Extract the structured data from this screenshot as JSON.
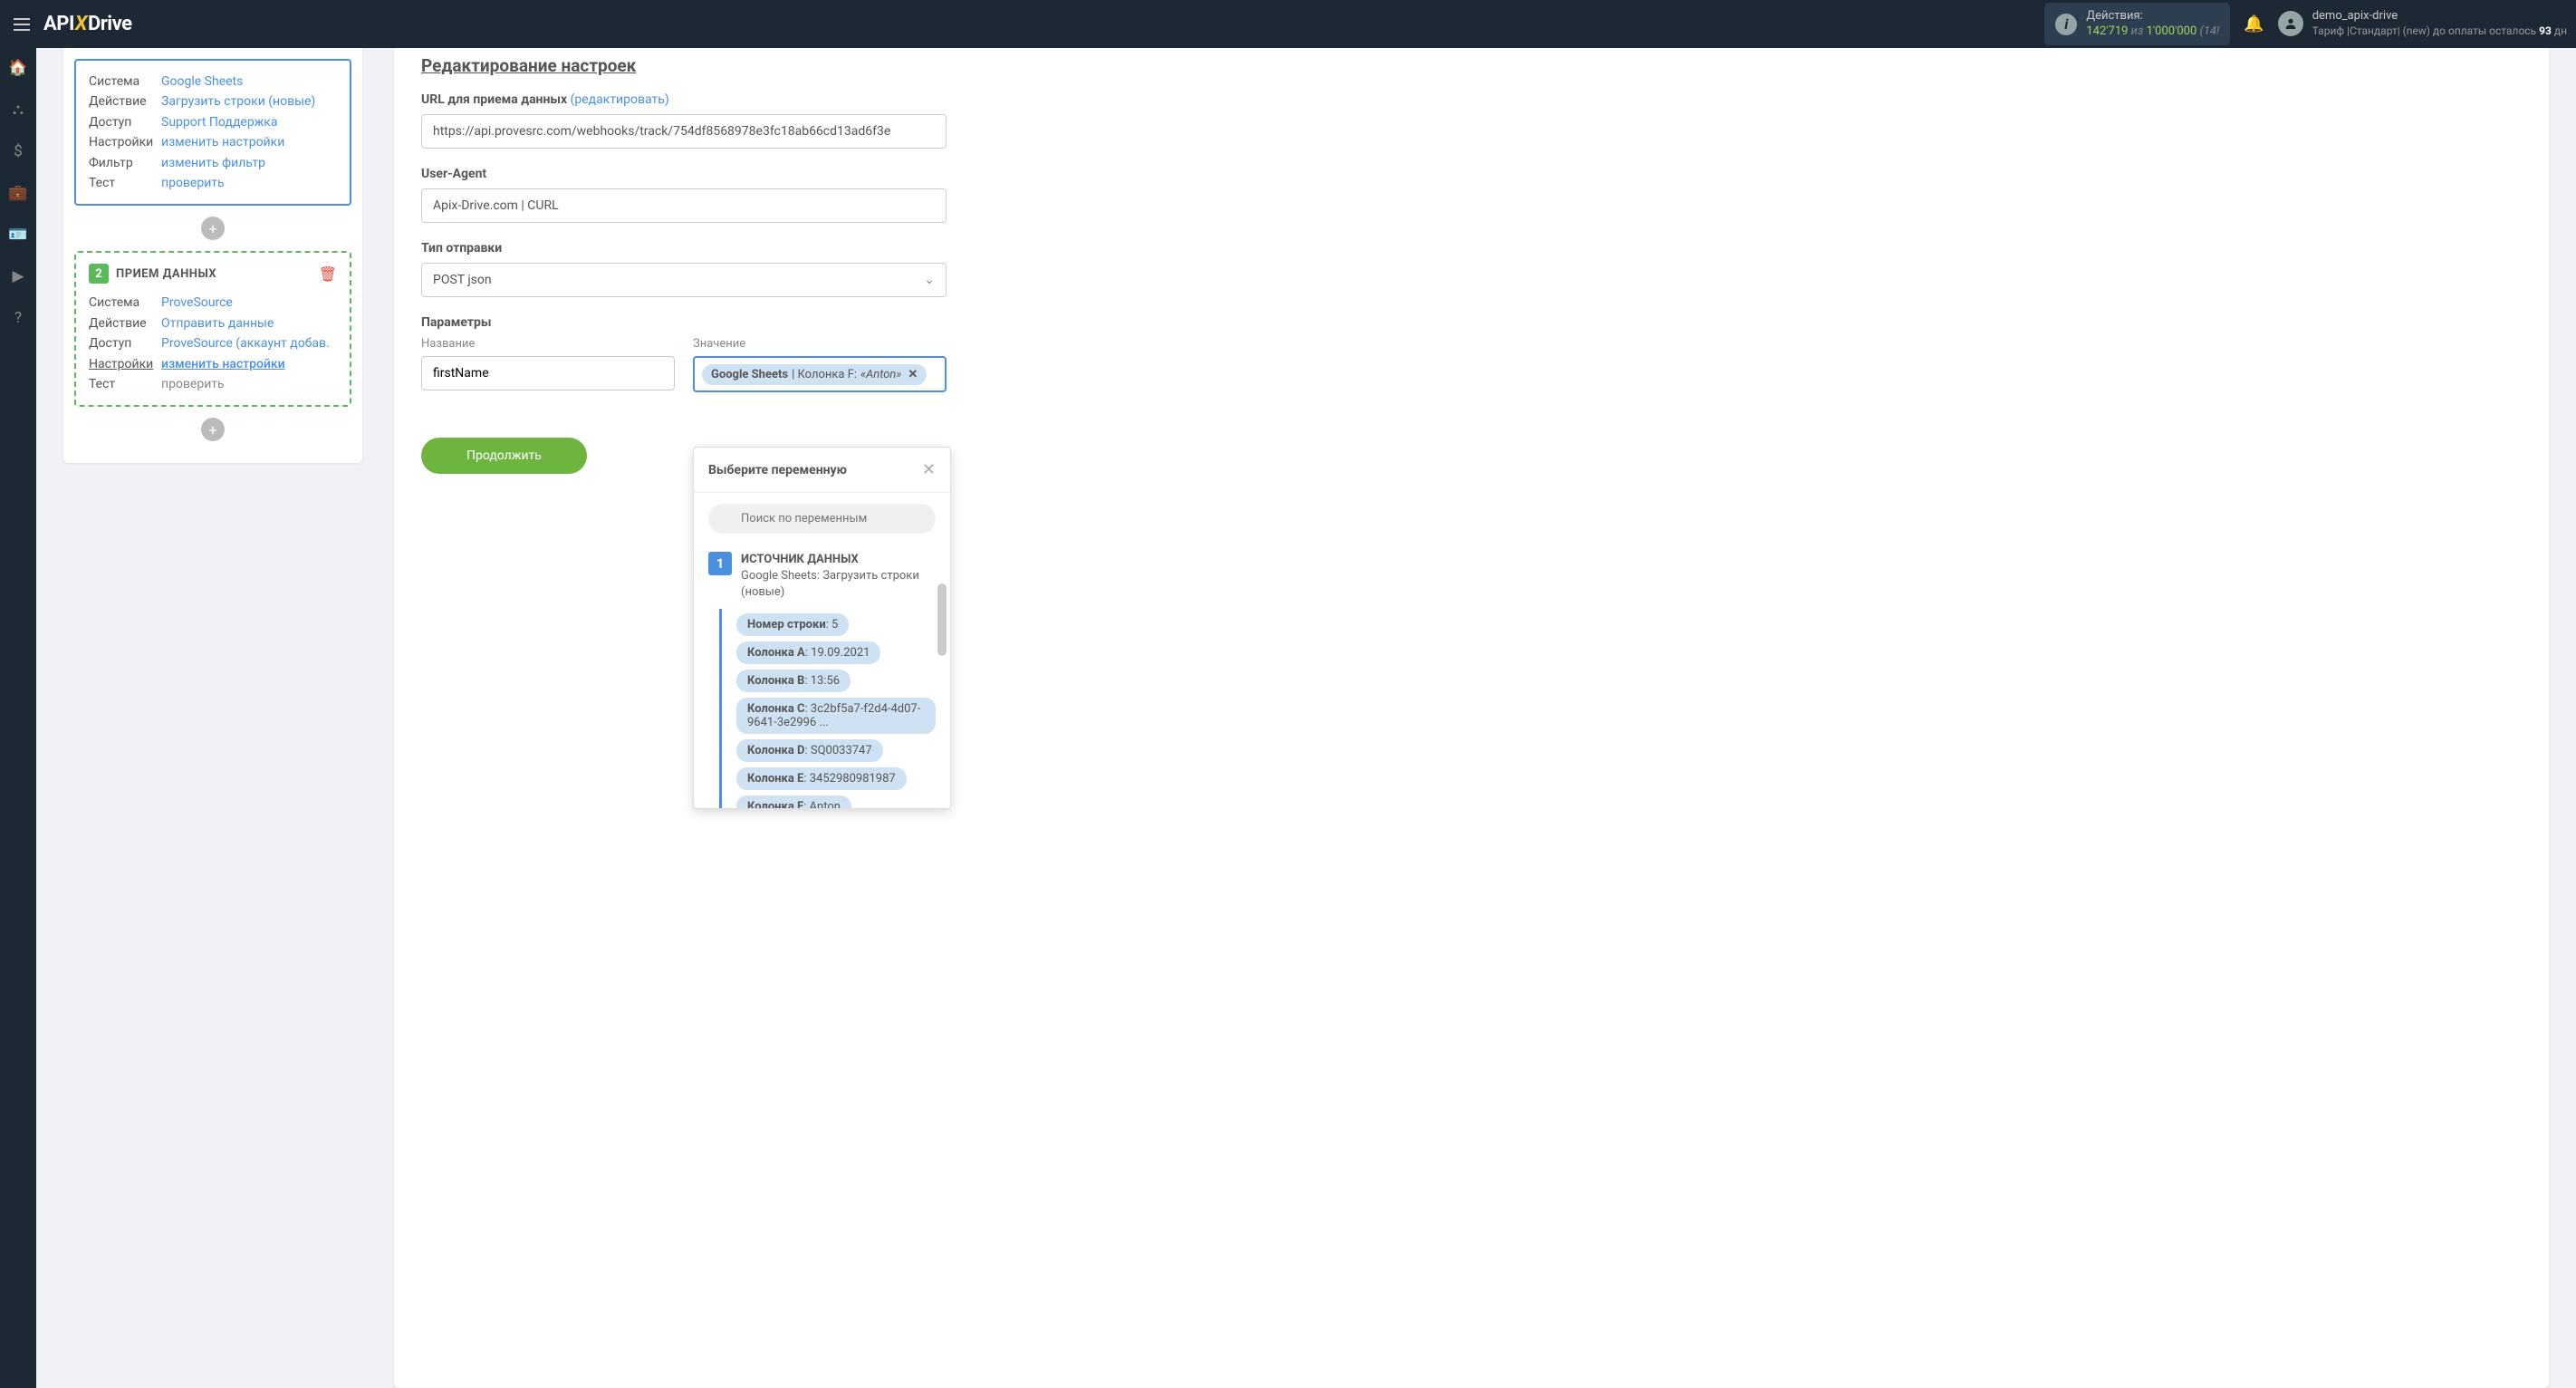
{
  "header": {
    "logo_api": "API",
    "logo_x": "X",
    "logo_drive": "Drive",
    "actions_label": "Действия:",
    "actions_count": "142'719",
    "actions_of": "из",
    "actions_total": "1'000'000",
    "actions_remainder": "(14!",
    "username": "demo_apix-drive",
    "tariff_prefix": "Тариф |Стандарт| (new) до оплаты осталось ",
    "tariff_days": "93",
    "tariff_suffix": " дн"
  },
  "card1": {
    "rows": [
      {
        "label": "Система",
        "value": "Google Sheets"
      },
      {
        "label": "Действие",
        "value": "Загрузить строки (новые)"
      },
      {
        "label": "Доступ",
        "value": "Support Поддержка"
      },
      {
        "label": "Настройки",
        "value": "изменить настройки"
      },
      {
        "label": "Фильтр",
        "value": "изменить фильтр"
      },
      {
        "label": "Тест",
        "value": "проверить"
      }
    ]
  },
  "card2": {
    "badge": "2",
    "title": "ПРИЕМ ДАННЫХ",
    "rows": [
      {
        "label": "Система",
        "value": "ProveSource",
        "cls": ""
      },
      {
        "label": "Действие",
        "value": "Отправить данные",
        "cls": ""
      },
      {
        "label": "Доступ",
        "value": "ProveSource (аккаунт добав.",
        "cls": ""
      },
      {
        "label": "Настройки",
        "value": "изменить настройки",
        "cls": "underline"
      },
      {
        "label": "Тест",
        "value": "проверить",
        "cls": "muted"
      }
    ]
  },
  "form": {
    "title": "Редактирование настроек",
    "url_label": "URL для приема данных",
    "url_edit": "(редактировать)",
    "url_value": "https://api.provesrc.com/webhooks/track/754df8568978e3fc18ab66cd13ad6f3e",
    "ua_label": "User-Agent",
    "ua_value": "Apix-Drive.com | CURL",
    "type_label": "Тип отправки",
    "type_value": "POST json",
    "params_label": "Параметры",
    "name_sublabel": "Название",
    "name_value": "firstName",
    "value_sublabel": "Значение",
    "tag_source": "Google Sheets",
    "tag_field": " | Колонка F: ",
    "tag_preview": "«Anton»",
    "continue": "Продолжить"
  },
  "dropdown": {
    "title": "Выберите переменную",
    "search_placeholder": "Поиск по переменным",
    "source_title": "ИСТОЧНИК ДАННЫХ",
    "source_sub": "Google Sheets: Загрузить строки (новые)",
    "items": [
      {
        "k": "Номер строки",
        "v": ": 5"
      },
      {
        "k": "Колонка A",
        "v": ": 19.09.2021"
      },
      {
        "k": "Колонка B",
        "v": ": 13:56"
      },
      {
        "k": "Колонка C",
        "v": ": 3c2bf5a7-f2d4-4d07-9641-3e2996 ..."
      },
      {
        "k": "Колонка D",
        "v": ": SQ0033747"
      },
      {
        "k": "Колонка E",
        "v": ": 3452980981987"
      },
      {
        "k": "Колонка F",
        "v": ": Anton"
      }
    ]
  }
}
